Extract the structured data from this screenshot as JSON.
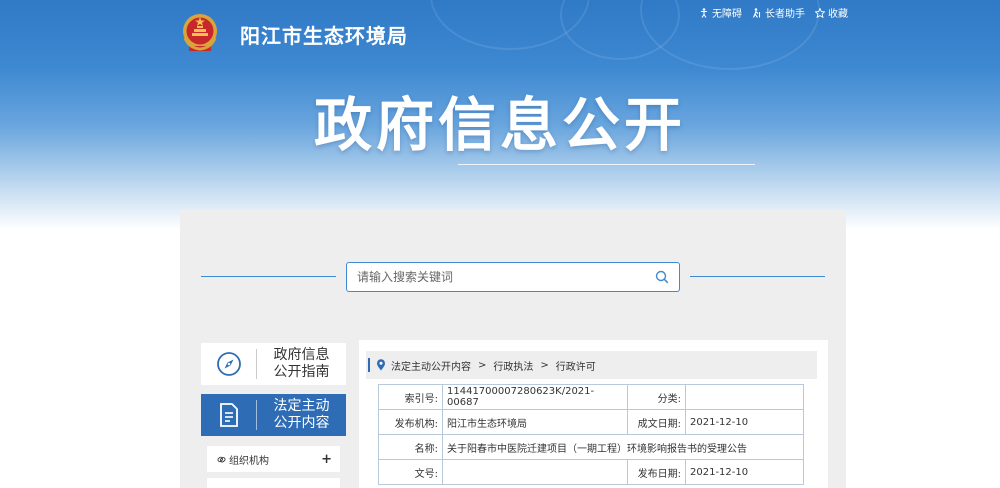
{
  "header": {
    "site_name": "阳江市生态环境局",
    "tools": [
      {
        "icon": "accessibility-icon",
        "label": "无障碍"
      },
      {
        "icon": "elderly-icon",
        "label": "长者助手"
      },
      {
        "icon": "star-icon",
        "label": "收藏"
      }
    ],
    "banner_title": "政府信息公开"
  },
  "search": {
    "placeholder": "请输入搜索关键词",
    "icon": "search-icon"
  },
  "sidebar": {
    "items": [
      {
        "label_line1": "政府信息",
        "label_line2": "公开指南",
        "icon": "compass-icon",
        "active": false
      },
      {
        "label_line1": "法定主动",
        "label_line2": "公开内容",
        "icon": "document-icon",
        "active": true
      }
    ],
    "subitems": [
      {
        "label": "组织机构",
        "icon": "link-icon",
        "expand": "+"
      }
    ]
  },
  "breadcrumb": {
    "icon": "location-pin-icon",
    "items": [
      "法定主动公开内容",
      "行政执法",
      "行政许可"
    ],
    "separator": ">"
  },
  "info_table": {
    "rows": [
      {
        "k1": "索引号:",
        "v1": "11441700007280623K/2021-00687",
        "k2": "分类:",
        "v2": ""
      },
      {
        "k1": "发布机构:",
        "v1": "阳江市生态环境局",
        "k2": "成文日期:",
        "v2": "2021-12-10"
      },
      {
        "k1": "名称:",
        "v1": "关于阳春市中医院迁建项目（一期工程）环境影响报告书的受理公告"
      },
      {
        "k1": "文号:",
        "v1": "",
        "k2": "发布日期:",
        "v2": "2021-12-10"
      }
    ]
  },
  "colors": {
    "banner_top": "#2f79c6",
    "accent": "#2e6db5",
    "panel_bg": "#eeeeee",
    "table_border": "#b9c9da"
  }
}
